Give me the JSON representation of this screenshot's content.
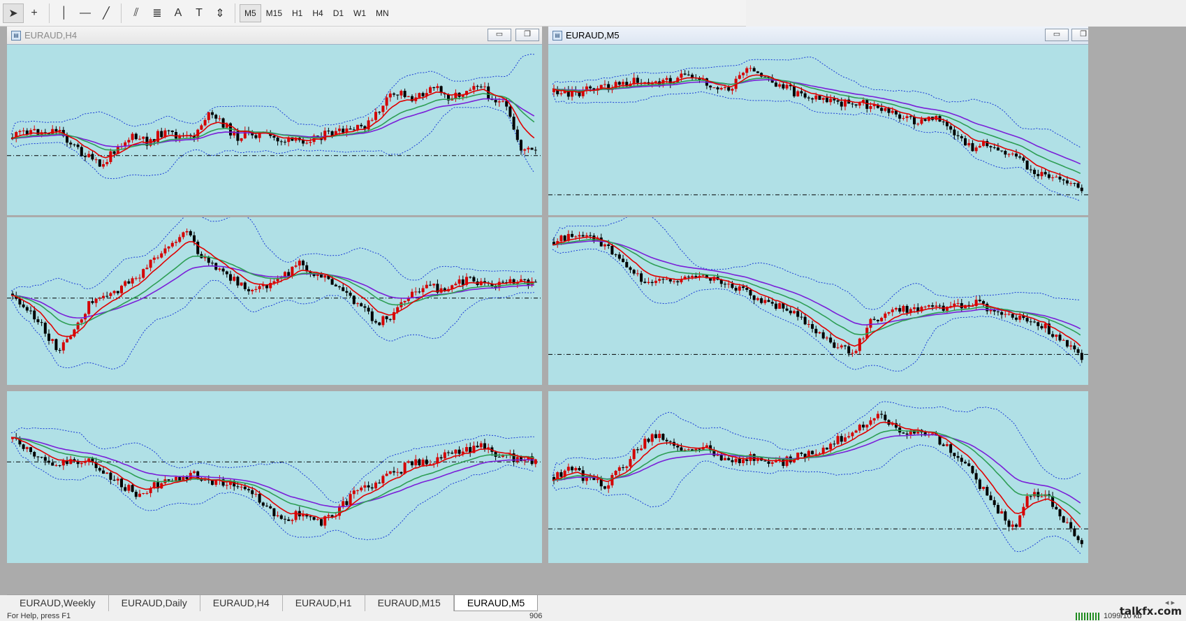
{
  "toolbar": {
    "tools": [
      {
        "name": "cursor-arrow",
        "glyph": "➤"
      },
      {
        "name": "crosshair",
        "glyph": "+"
      },
      {
        "name": "vertical-line",
        "glyph": "│"
      },
      {
        "name": "horizontal-line",
        "glyph": "—"
      },
      {
        "name": "trend-line",
        "glyph": "╱"
      },
      {
        "name": "equidistant-channel",
        "glyph": "⫽"
      },
      {
        "name": "fibonacci-retracement",
        "glyph": "≣"
      },
      {
        "name": "text",
        "glyph": "A"
      },
      {
        "name": "text-label",
        "glyph": "T"
      },
      {
        "name": "arrows",
        "glyph": "⇕"
      }
    ],
    "timeframes": [
      "M5",
      "M15",
      "H1",
      "H4",
      "D1",
      "W1",
      "MN"
    ],
    "active_timeframe": "M5"
  },
  "windows": {
    "h4": {
      "title": "EURAUD,H4",
      "active": false
    },
    "m5": {
      "title": "EURAUD,M5",
      "active": true
    }
  },
  "tabs": [
    "EURAUD,Weekly",
    "EURAUD,Daily",
    "EURAUD,H4",
    "EURAUD,H1",
    "EURAUD,M15",
    "EURAUD,M5"
  ],
  "active_tab": "EURAUD,M5",
  "status": {
    "help": "For Help, press F1",
    "value": "906",
    "traffic": "1099/10 kb"
  },
  "watermark": "talkfx.com",
  "colors": {
    "chart_bg": "#b0e0e6",
    "candle": "#d40000",
    "candle_dark": "#000000",
    "ma_fast": "#e00000",
    "ma_mid": "#2e9e55",
    "ma_slow": "#7a1fd8",
    "band": "#1a3cd6",
    "level": "#000000"
  },
  "chart_data": [
    {
      "type": "line",
      "panel": "top-left",
      "points": [
        0.55,
        0.5,
        0.52,
        0.49,
        0.6,
        0.68,
        0.75,
        0.6,
        0.55,
        0.58,
        0.52,
        0.54,
        0.56,
        0.4,
        0.45,
        0.55,
        0.52,
        0.54,
        0.57,
        0.58,
        0.55,
        0.53,
        0.52,
        0.5,
        0.45,
        0.3,
        0.25,
        0.3,
        0.2,
        0.28,
        0.26,
        0.18,
        0.28,
        0.35,
        0.62,
        0.65
      ]
    },
    {
      "type": "line",
      "panel": "top-right",
      "points": [
        0.25,
        0.26,
        0.24,
        0.22,
        0.2,
        0.18,
        0.2,
        0.17,
        0.15,
        0.16,
        0.2,
        0.24,
        0.1,
        0.15,
        0.2,
        0.25,
        0.28,
        0.3,
        0.32,
        0.31,
        0.35,
        0.38,
        0.42,
        0.45,
        0.4,
        0.55,
        0.62,
        0.6,
        0.62,
        0.7,
        0.78,
        0.82,
        0.86,
        0.9
      ]
    },
    {
      "type": "line",
      "panel": "middle-left",
      "points": [
        0.45,
        0.55,
        0.7,
        0.85,
        0.65,
        0.5,
        0.45,
        0.4,
        0.35,
        0.2,
        0.1,
        0.05,
        0.2,
        0.3,
        0.35,
        0.45,
        0.4,
        0.35,
        0.25,
        0.3,
        0.35,
        0.45,
        0.55,
        0.65,
        0.6,
        0.45,
        0.4,
        0.42,
        0.38,
        0.35,
        0.4,
        0.38,
        0.35,
        0.4
      ]
    },
    {
      "type": "line",
      "panel": "middle-right",
      "points": [
        0.1,
        0.06,
        0.08,
        0.12,
        0.25,
        0.35,
        0.38,
        0.35,
        0.33,
        0.35,
        0.38,
        0.45,
        0.5,
        0.55,
        0.6,
        0.7,
        0.8,
        0.85,
        0.65,
        0.58,
        0.56,
        0.55,
        0.54,
        0.53,
        0.52,
        0.55,
        0.6,
        0.62,
        0.68,
        0.78,
        0.9
      ]
    },
    {
      "type": "line",
      "panel": "bottom-left",
      "points": [
        0.25,
        0.35,
        0.4,
        0.42,
        0.38,
        0.45,
        0.55,
        0.62,
        0.55,
        0.5,
        0.48,
        0.52,
        0.55,
        0.58,
        0.7,
        0.78,
        0.74,
        0.8,
        0.72,
        0.6,
        0.55,
        0.48,
        0.42,
        0.4,
        0.35,
        0.32,
        0.3,
        0.36,
        0.38,
        0.4
      ]
    },
    {
      "type": "line",
      "panel": "bottom-right",
      "points": [
        0.5,
        0.45,
        0.52,
        0.55,
        0.45,
        0.3,
        0.22,
        0.28,
        0.35,
        0.32,
        0.38,
        0.4,
        0.36,
        0.42,
        0.38,
        0.34,
        0.3,
        0.24,
        0.18,
        0.1,
        0.18,
        0.2,
        0.22,
        0.28,
        0.4,
        0.55,
        0.7,
        0.85,
        0.6,
        0.62,
        0.78,
        0.92
      ]
    }
  ]
}
